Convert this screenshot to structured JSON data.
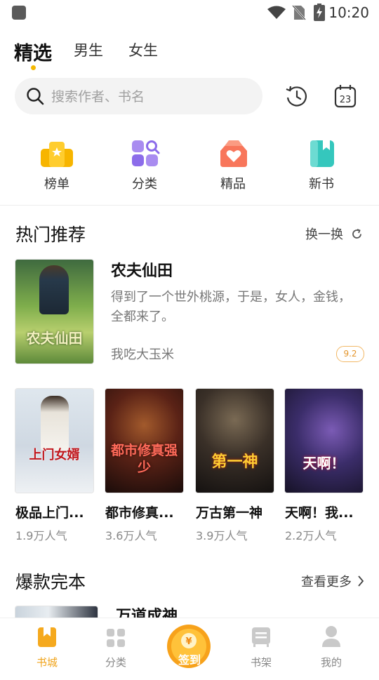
{
  "status_bar": {
    "time": "10:20"
  },
  "tabs": [
    {
      "label": "精选"
    },
    {
      "label": "男生"
    },
    {
      "label": "女生"
    }
  ],
  "search": {
    "placeholder": "搜索作者、书名"
  },
  "quick_entries": [
    {
      "label": "榜单",
      "icon": "ranking-icon"
    },
    {
      "label": "分类",
      "icon": "category-icon"
    },
    {
      "label": "精品",
      "icon": "premium-icon"
    },
    {
      "label": "新书",
      "icon": "new-book-icon"
    }
  ],
  "hot_section": {
    "title": "热门推荐",
    "refresh_label": "换一换",
    "featured": {
      "title": "农夫仙田",
      "description": "得到了一个世外桃源，于是，女人，金钱，全都来了。",
      "author": "我吃大玉米",
      "score": "9.2",
      "cover_text": "农夫仙田"
    },
    "books": [
      {
        "title": "极品上门...",
        "popularity": "1.9万人气",
        "cover_text": "上门女婿"
      },
      {
        "title": "都市修真...",
        "popularity": "3.6万人气",
        "cover_text": "都市修真强少"
      },
      {
        "title": "万古第一神",
        "popularity": "3.9万人气",
        "cover_text": "第一神"
      },
      {
        "title": "天啊！我...",
        "popularity": "2.2万人气",
        "cover_text": "天啊！"
      }
    ]
  },
  "complete_section": {
    "title": "爆款完本",
    "more_label": "查看更多",
    "first_book_title": "万道成神"
  },
  "bottom_nav": [
    {
      "label": "书城",
      "active": true
    },
    {
      "label": "分类",
      "active": false
    },
    {
      "label": "签到",
      "active": false
    },
    {
      "label": "书架",
      "active": false
    },
    {
      "label": "我的",
      "active": false
    }
  ],
  "colors": {
    "accent": "#f5b800",
    "nav_active": "#f0a41c"
  }
}
